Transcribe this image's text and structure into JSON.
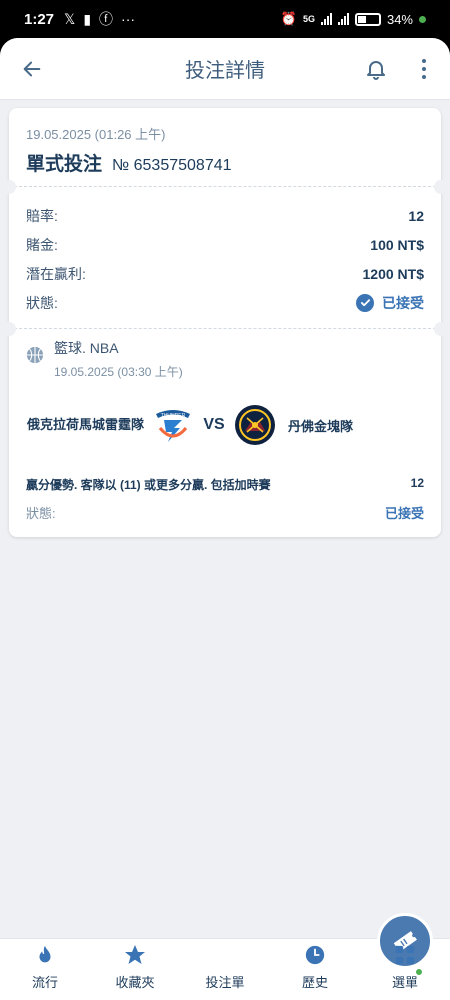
{
  "status_bar": {
    "time": "1:27",
    "battery": "34%",
    "network": "5G"
  },
  "header": {
    "title": "投注詳情"
  },
  "bet": {
    "date": "19.05.2025 (01:26 上午)",
    "type": "單式投注",
    "number": "№ 65357508741",
    "details": [
      {
        "label": "賠率:",
        "value": "12"
      },
      {
        "label": "賭金:",
        "value": "100 NT$"
      },
      {
        "label": "潛在贏利:",
        "value": "1200 NT$"
      }
    ],
    "status_label": "狀態:",
    "status_value": "已接受"
  },
  "event": {
    "league": "籃球. NBA",
    "date": "19.05.2025 (03:30 上午)",
    "home_team": "俄克拉荷馬城雷霆隊",
    "vs": "VS",
    "away_team": "丹佛金塊隊",
    "selection": "贏分優勢. 客隊以 (11) 或更多分贏. 包括加時賽",
    "selection_odds": "12",
    "status_label": "狀態:",
    "status_value": "已接受"
  },
  "bottom_nav": [
    {
      "label": "流行",
      "icon": "flame-icon"
    },
    {
      "label": "收藏夾",
      "icon": "star-icon"
    },
    {
      "label": "投注單",
      "icon": "ticket-icon"
    },
    {
      "label": "歷史",
      "icon": "clock-icon"
    },
    {
      "label": "選單",
      "icon": "grid-icon"
    }
  ],
  "colors": {
    "primary": "#1d3b5a",
    "accent": "#3a74b5",
    "background": "#eef0f3"
  }
}
